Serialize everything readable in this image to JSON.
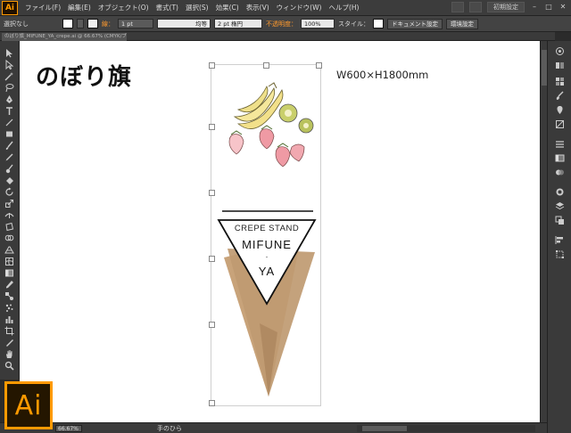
{
  "app": {
    "logo_text": "Ai",
    "badge_text": "Ai",
    "brand_color": "#ff9a00"
  },
  "menu": {
    "items": [
      "ファイル(F)",
      "編集(E)",
      "オブジェクト(O)",
      "書式(T)",
      "選択(S)",
      "効果(C)",
      "表示(V)",
      "ウィンドウ(W)",
      "ヘルプ(H)"
    ],
    "workspace": "初期設定"
  },
  "control_bar": {
    "selection_label": "選択なし",
    "stroke_label": "線：",
    "stroke_weight": "1 pt",
    "stroke_style": "均等",
    "brush": "2 pt 楕円",
    "opacity_label": "不透明度：",
    "opacity_value": "100%",
    "style_label": "スタイル：",
    "document_setup": "ドキュメント設定",
    "preferences": "環境設定"
  },
  "document": {
    "tab_title": "のぼり旗_MIFUNE_YA_crepe.ai @ 66.67% (CMYK/プレビュー)"
  },
  "artwork": {
    "heading": "のぼり旗",
    "dimensions": "W600×H1800mm",
    "brand_line1": "CREPE STAND",
    "brand_line2": "MIFUNE",
    "brand_dot": "·",
    "brand_line3": "YA",
    "colors": {
      "kraft": "#c8a37a",
      "kraft_dark": "#b58f67",
      "banana": "#f2e08a",
      "kiwi": "#a9b85a",
      "strawberry": "#e56b78"
    }
  },
  "status_bar": {
    "zoom": "66.67%",
    "tool_text": "手のひら"
  },
  "icons": {
    "tools": [
      "selection-icon",
      "direct-selection-icon",
      "magic-wand-icon",
      "lasso-icon",
      "pen-icon",
      "type-icon",
      "line-icon",
      "rectangle-icon",
      "paintbrush-icon",
      "pencil-icon",
      "blob-brush-icon",
      "eraser-icon",
      "rotate-icon",
      "scale-icon",
      "width-icon",
      "free-transform-icon",
      "shape-builder-icon",
      "perspective-icon",
      "mesh-icon",
      "gradient-icon",
      "eyedropper-icon",
      "blend-icon",
      "symbol-sprayer-icon",
      "column-graph-icon",
      "artboard-icon",
      "slice-icon",
      "hand-icon",
      "zoom-icon"
    ],
    "panels": [
      "color-panel-icon",
      "color-guide-icon",
      "swatches-icon",
      "brushes-icon",
      "symbols-icon",
      "graphic-styles-icon",
      "stroke-icon",
      "gradient-panel-icon",
      "transparency-icon",
      "appearance-icon",
      "layers-icon",
      "artboards-icon",
      "align-icon",
      "transform-icon"
    ]
  }
}
